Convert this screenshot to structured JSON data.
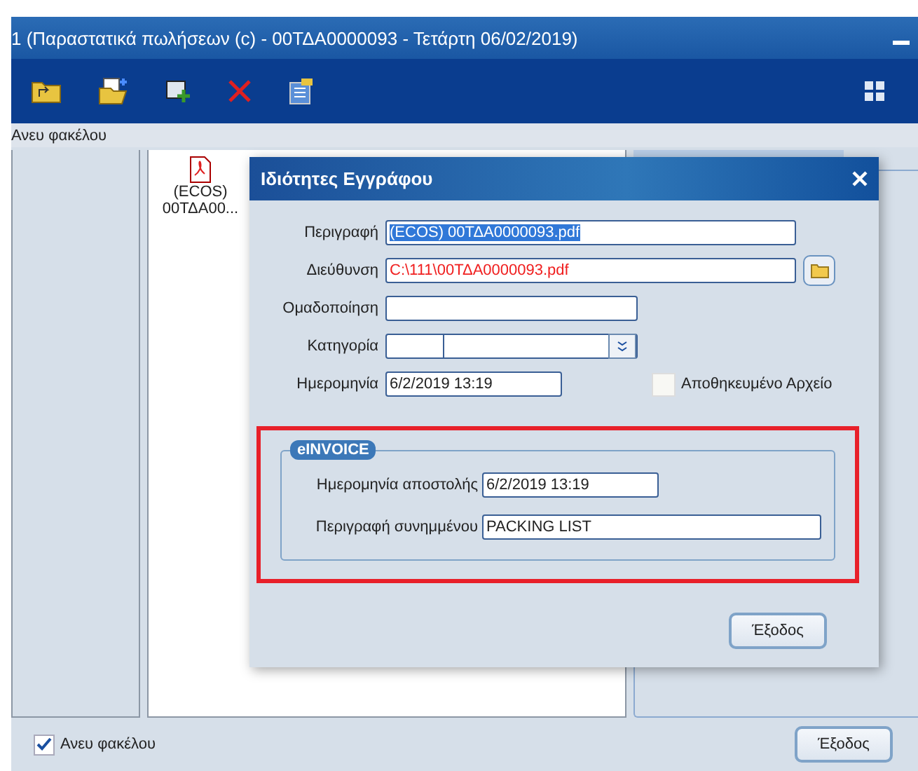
{
  "window": {
    "title": "1 (Παραστατικά πωλήσεων (c) - 00ΤΔΑ0000093 - Τετάρτη 06/02/2019)"
  },
  "toolbar": {
    "buttons": [
      {
        "kind": "folder-up"
      },
      {
        "kind": "open"
      },
      {
        "kind": "add"
      },
      {
        "kind": "delete"
      },
      {
        "kind": "properties"
      }
    ]
  },
  "folder_label": "Ανευ φακέλου",
  "files": [
    {
      "name": "(ECOS) 00ΤΔΑ00..."
    }
  ],
  "dialog": {
    "title": "Ιδιότητες Εγγράφου",
    "fields": [
      {
        "kind": "text",
        "label": "Περιγραφή",
        "value": "(ECOS) 00ΤΔΑ0000093.pdf",
        "text_selected": true
      },
      {
        "kind": "path",
        "label": "Διεύθυνση",
        "value": "C:\\111\\00ΤΔΑ0000093.pdf"
      },
      {
        "kind": "short",
        "label": "Ομαδοποίηση"
      },
      {
        "kind": "combo",
        "label": "Κατηγορία"
      },
      {
        "kind": "date",
        "label": "Ημερομηνία",
        "value": "6/2/2019 13:19"
      }
    ],
    "archived": {
      "label": "Αποθηκευμένο Αρχείο",
      "checked": false
    },
    "einvoice": {
      "title": "eINVOICE",
      "highlighted": true,
      "fields": [
        {
          "kind": "date",
          "label": "Ημερομηνία αποστολής",
          "value": "6/2/2019 13:19"
        },
        {
          "kind": "text",
          "label": "Περιγραφή συνημμένου",
          "value": "PACKING LIST"
        }
      ]
    },
    "exit_button": "Έξοδος"
  },
  "footer": {
    "without_folder": {
      "label": "Ανευ φακέλου",
      "checked": true
    },
    "exit_button": "Έξοδος"
  }
}
